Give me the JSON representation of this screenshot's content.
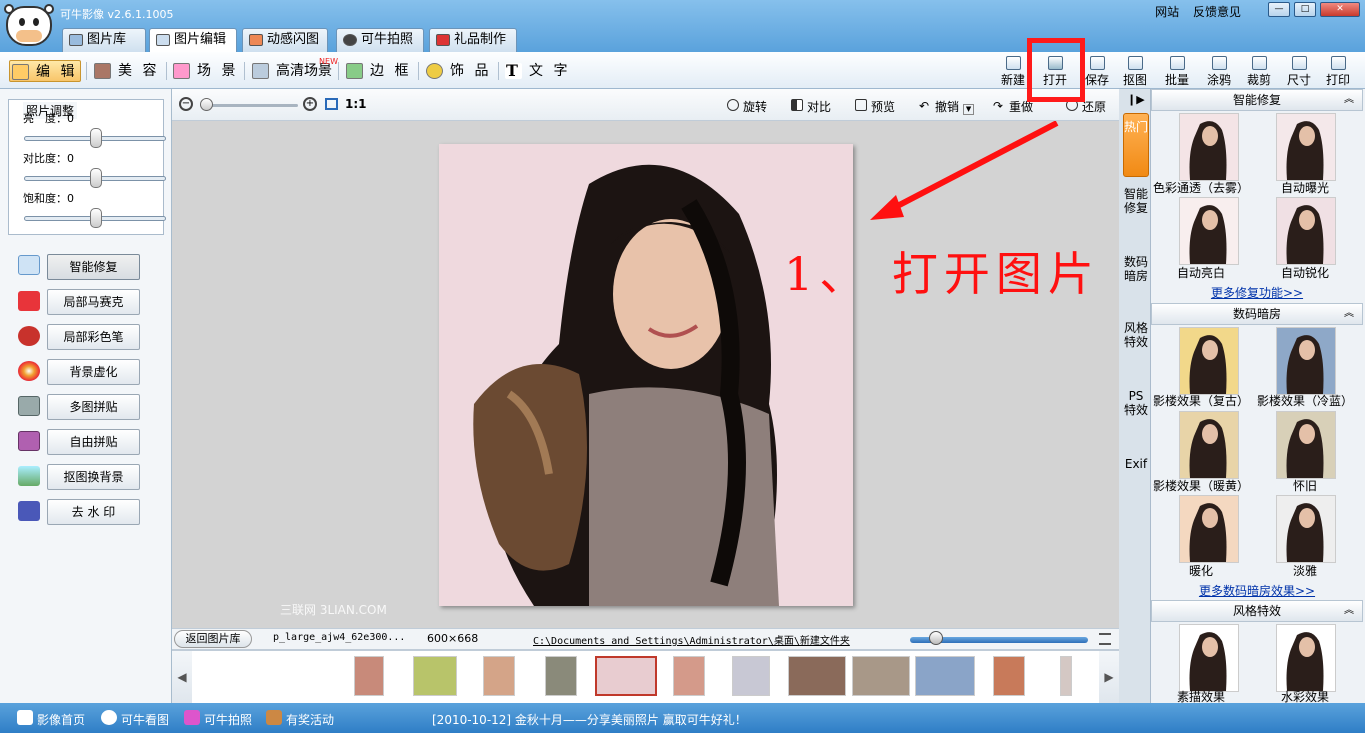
{
  "window": {
    "title": "可牛影像 v2.6.1.1005",
    "links": [
      "网站",
      "反馈意见"
    ],
    "controls": [
      "minimize",
      "maximize",
      "close"
    ]
  },
  "main_tabs": [
    {
      "label": "图片库",
      "icon": "photo-library-icon"
    },
    {
      "label": "图片编辑",
      "icon": "photo-edit-icon",
      "active": true
    },
    {
      "label": "动感闪图",
      "icon": "flash-gif-icon"
    },
    {
      "label": "可牛拍照",
      "icon": "camera-icon"
    },
    {
      "label": "礼品制作",
      "icon": "gift-icon"
    }
  ],
  "toolbar": {
    "items": [
      {
        "label": "编 辑",
        "icon": "edit-icon",
        "active": true
      },
      {
        "label": "美 容",
        "icon": "beauty-icon"
      },
      {
        "label": "场 景",
        "icon": "scene-icon"
      },
      {
        "label": "高清场景",
        "icon": "hd-scene-icon",
        "badge": "NEW"
      },
      {
        "label": "边 框",
        "icon": "frame-icon"
      },
      {
        "label": "饰 品",
        "icon": "accessory-icon"
      },
      {
        "label": "文 字",
        "icon": "text-icon"
      }
    ],
    "right_tools": [
      {
        "label": "新建",
        "icon": "new-file-icon"
      },
      {
        "label": "打开",
        "icon": "open-folder-icon"
      },
      {
        "label": "保存",
        "icon": "save-icon"
      },
      {
        "label": "抠图",
        "icon": "cutout-icon"
      },
      {
        "label": "批量",
        "icon": "batch-icon"
      },
      {
        "label": "涂鸦",
        "icon": "doodle-icon"
      },
      {
        "label": "裁剪",
        "icon": "crop-icon"
      },
      {
        "label": "尺寸",
        "icon": "resize-icon"
      },
      {
        "label": "打印",
        "icon": "print-icon"
      }
    ]
  },
  "adjust": {
    "title": "照片调整",
    "sliders": [
      {
        "label": "亮　度：",
        "value": "0"
      },
      {
        "label": "对比度：",
        "value": "0"
      },
      {
        "label": "饱和度：",
        "value": "0"
      }
    ]
  },
  "left_tools": [
    {
      "label": "智能修复",
      "icon": "magic-wand-icon",
      "color": "#6aa0d8"
    },
    {
      "label": "局部马赛克",
      "icon": "mosaic-icon",
      "color": "#e8343a"
    },
    {
      "label": "局部彩色笔",
      "icon": "color-pen-icon",
      "color": "#c8322c"
    },
    {
      "label": "背景虚化",
      "icon": "blur-icon",
      "color": "#f0a030"
    },
    {
      "label": "多图拼贴",
      "icon": "multi-collage-icon",
      "color": "#8a9aaa"
    },
    {
      "label": "自由拼贴",
      "icon": "free-collage-icon",
      "color": "#b060b0"
    },
    {
      "label": "抠图换背景",
      "icon": "change-bg-icon",
      "color": "#60a860"
    },
    {
      "label": "去 水 印",
      "icon": "remove-watermark-icon",
      "color": "#4a58b8"
    }
  ],
  "canvas_toolbar": {
    "zoom_ratio": "1:1",
    "zoom_level": 0,
    "actions": [
      {
        "label": "旋转",
        "icon": "rotate-icon"
      },
      {
        "label": "对比",
        "icon": "compare-icon"
      },
      {
        "label": "预览",
        "icon": "preview-icon"
      },
      {
        "label": "撤销",
        "icon": "undo-icon"
      },
      {
        "label": "重做",
        "icon": "redo-icon"
      },
      {
        "label": "还原",
        "icon": "restore-icon"
      }
    ]
  },
  "annotation": "1、 打开图片",
  "watermark": "三联网 3LIAN.COM",
  "infobar": {
    "back_label": "返回图片库",
    "filename": "p_large_ajw4_62e300...",
    "dimensions": "600×668",
    "path": "C:\\Documents and Settings\\Administrator\\桌面\\新建文件夹",
    "thumb_size_level": 0.15
  },
  "filmstrip": {
    "prev": "◀",
    "next": "▶",
    "thumb_count": 12,
    "selected_index": 4
  },
  "right_panel": {
    "vtabs": [
      "热门",
      "智能修复",
      "数码暗房",
      "风格特效",
      "PS特效",
      "Exif"
    ],
    "sections": [
      {
        "title": "智能修复",
        "items": [
          "色彩通透（去雾）",
          "自动曝光",
          "自动亮白",
          "自动锐化"
        ],
        "more": "更多修复功能>>"
      },
      {
        "title": "数码暗房",
        "items": [
          "影楼效果（复古）",
          "影楼效果（冷蓝）",
          "影楼效果（暖黄）",
          "怀旧",
          "暖化",
          "淡雅"
        ],
        "more": "更多数码暗房效果>>"
      },
      {
        "title": "风格特效",
        "items": [
          "素描效果",
          "水彩效果"
        ]
      }
    ]
  },
  "statusbar": {
    "items": [
      {
        "label": "影像首页",
        "icon": "cow-home-icon"
      },
      {
        "label": "可牛看图",
        "icon": "eye-viewer-icon"
      },
      {
        "label": "可牛拍照",
        "icon": "camera-icon"
      },
      {
        "label": "有奖活动",
        "icon": "prize-icon"
      }
    ],
    "news": "[2010-10-12] 金秋十月——分享美丽照片 赢取可牛好礼！"
  },
  "colors": {
    "accent": "#5aa2dc",
    "highlight_box": "#ff1a1a",
    "annotation": "#ff1010",
    "active_tab": "#f8c56a"
  }
}
